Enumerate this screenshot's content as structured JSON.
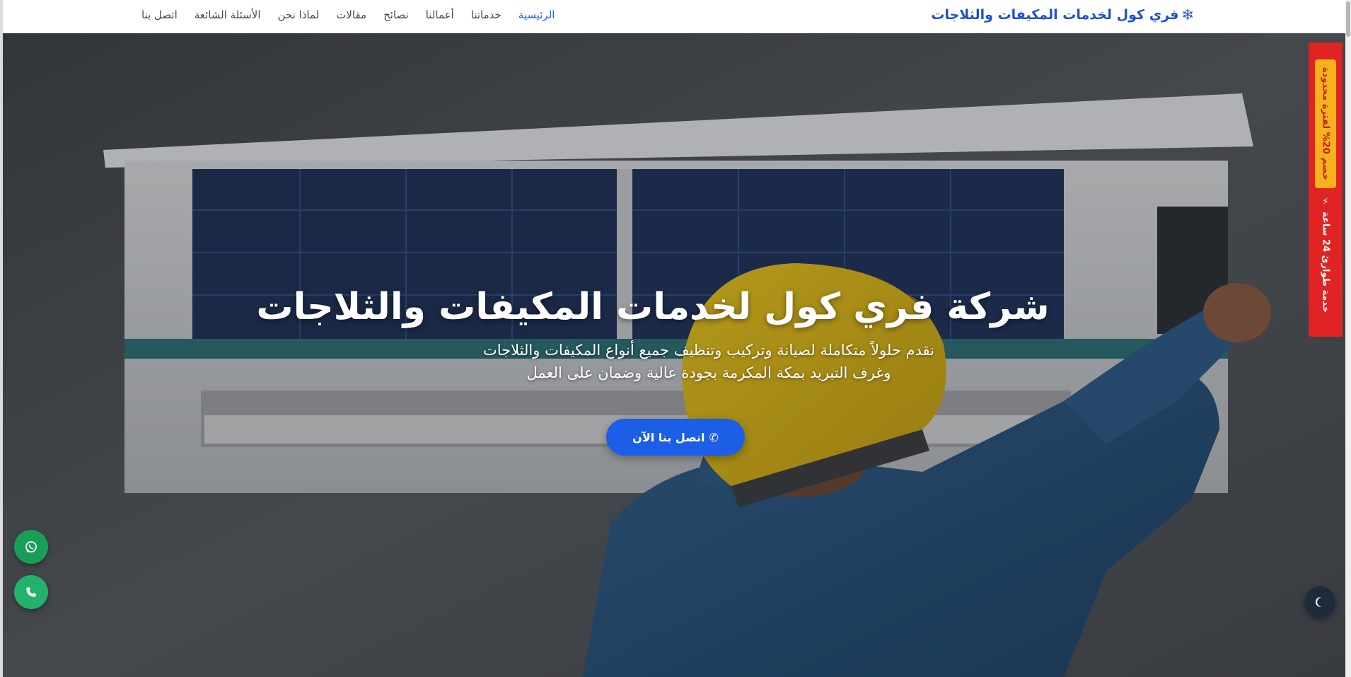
{
  "brand": {
    "icon": "snowflake-icon",
    "glyph": "❄",
    "title": "فري كول لخدمات المكيفات والثلاجات",
    "color": "#1d4fd1"
  },
  "nav": {
    "items": [
      {
        "label": "الرئيسية",
        "active": true
      },
      {
        "label": "خدماتنا"
      },
      {
        "label": "أعمالنا"
      },
      {
        "label": "نصائح"
      },
      {
        "label": "مقالات"
      },
      {
        "label": "لماذا نحن"
      },
      {
        "label": "الأسئلة الشائعة"
      },
      {
        "label": "اتصل بنا"
      }
    ],
    "active_color": "#2563eb"
  },
  "hero": {
    "title": "شركة فري كول لخدمات المكيفات والثلاجات",
    "subtitle_line1": "نقدم حلولاً متكاملة لصيانة وتركيب وتنظيف جميع أنواع المكيفات والثلاجات",
    "subtitle_line2": "وغرف التبريد بمكة المكرمة بجودة عالية وضمان على العمل",
    "cta_label": "اتصل بنا الآن",
    "cta_icon": "phone-icon",
    "cta_color": "#1d5ee6"
  },
  "ribbon": {
    "badge": "خصم 20% لفترة محدودة",
    "text": "خدمة طوارئ 24 ساعة",
    "icon": "lightning-icon",
    "color": "#e02323",
    "badge_color": "#f5b21c"
  },
  "floating": {
    "whatsapp_icon": "whatsapp-icon",
    "call_icon": "phone-icon",
    "theme_icon": "moon-icon"
  }
}
